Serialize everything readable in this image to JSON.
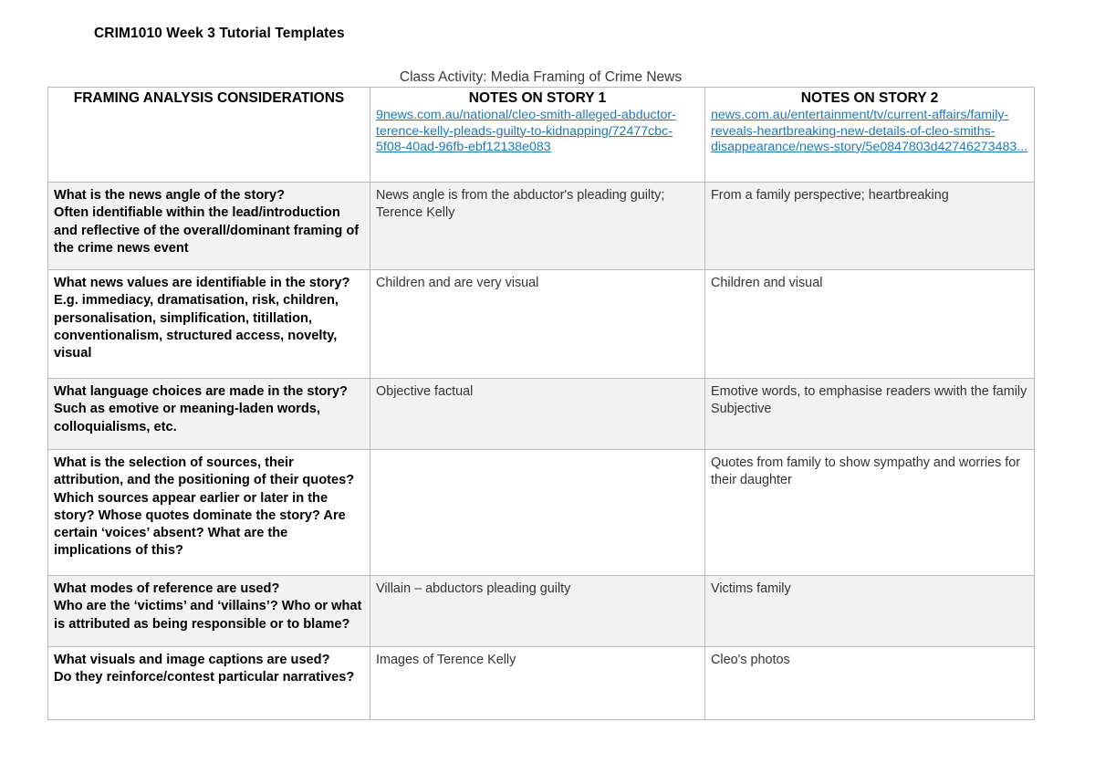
{
  "document": {
    "title": "CRIM1010 Week 3 Tutorial Templates",
    "activity_caption": "Class Activity: Media Framing of Crime News"
  },
  "link_color": "#2178b5",
  "shaded_row_color": "#f2f2f2",
  "border_color": "#b9b9b9",
  "table": {
    "headers": {
      "consideration": "FRAMING ANALYSIS CONSIDERATIONS",
      "story1": "NOTES ON STORY 1",
      "story2": "NOTES ON STORY 2"
    },
    "urls": {
      "story1": "9news.com.au/national/cleo-smith-alleged-abductor-terence-kelly-pleads-guilty-to-kidnapping/72477cbc-5f08-40ad-96fb-ebf12138e083",
      "story2": "news.com.au/entertainment/tv/current-affairs/family-reveals-heartbreaking-new-details-of-cleo-smiths-disappearance/news-story/5e0847803d42746273483..."
    },
    "rows": [
      {
        "consideration": [
          "What is the news angle of the story?",
          "Often identifiable within the lead/introduction and reflective of the overall/dominant framing of the crime news event"
        ],
        "story1": [
          "News angle is from the abductor's pleading guilty; Terence Kelly"
        ],
        "story2": [
          "From a family perspective; heartbreaking"
        ]
      },
      {
        "consideration": [
          "What news values are identifiable in the story?",
          "E.g. immediacy, dramatisation, risk, children, personalisation, simplification, titillation, conventionalism, structured access, novelty, visual"
        ],
        "story1": [
          "Children and are very visual"
        ],
        "story2": [
          "Children and visual"
        ]
      },
      {
        "consideration": [
          "What language choices are made in the story?",
          "Such as emotive or meaning-laden words, colloquialisms, etc."
        ],
        "story1": [
          "Objective factual"
        ],
        "story2": [
          "Emotive words, to emphasise readers wwith the family",
          "Subjective"
        ]
      },
      {
        "consideration": [
          "What is the selection of sources, their attribution, and the positioning of their quotes?",
          "Which sources appear earlier or later in the story? Whose quotes dominate the story? Are certain ‘voices’ absent? What are the implications of this?"
        ],
        "story1": [],
        "story2": [
          "Quotes from family to show sympathy and worries for their daughter"
        ]
      },
      {
        "consideration": [
          "What modes of reference are used?",
          "Who are the ‘victims’ and ‘villains’? Who or what is attributed as being responsible or to blame?"
        ],
        "story1": [
          "Villain – abductors pleading guilty"
        ],
        "story2": [
          "Victims family"
        ]
      },
      {
        "consideration": [
          "What visuals and image captions are used?",
          "Do they reinforce/contest particular narratives?"
        ],
        "story1": [
          "Images of Terence Kelly"
        ],
        "story2": [
          "Cleo's photos"
        ]
      }
    ]
  }
}
